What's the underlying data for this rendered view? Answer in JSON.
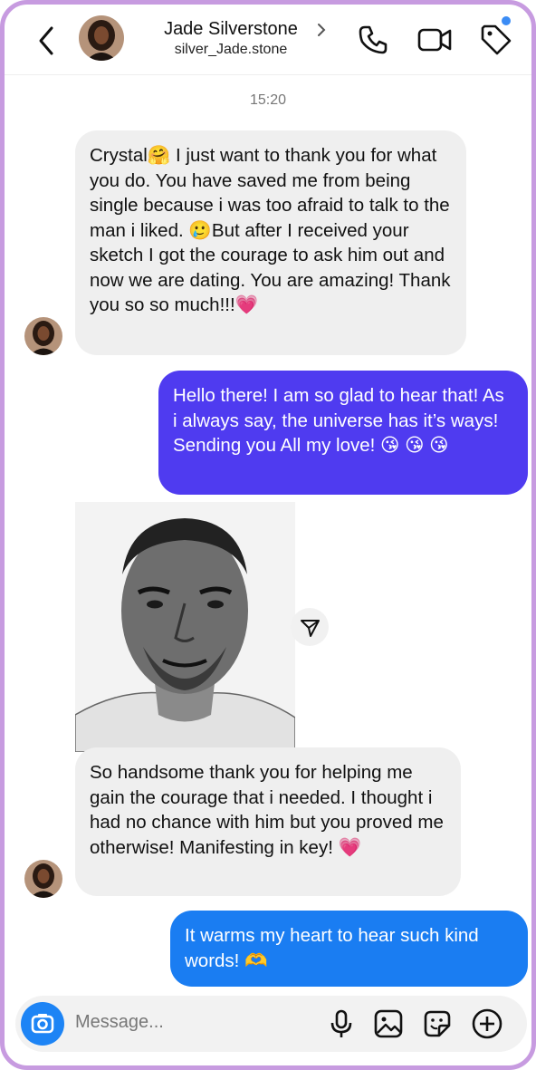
{
  "header": {
    "name": "Jade Silverstone",
    "username": "silver_Jade.stone"
  },
  "conversation": {
    "timestamp": "15:20",
    "messages": [
      {
        "side": "in",
        "text": "Crystal🤗 I just want to thank you for what you do. You have saved me from being single because i was too afraid to talk to the man i liked. 🥲But after I received your sketch I got the courage to ask him out and now we are dating. You are amazing! Thank you so so much!!!💗"
      },
      {
        "side": "out",
        "text": "Hello there! I am so glad to hear that! As i always say, the universe has it’s ways! Sending you All my love! 😘 😘 😘"
      },
      {
        "side": "in",
        "text": "So handsome thank you for helping me gain the courage that i needed. I thought i had no chance with him but you proved me otherwise! Manifesting in key! 💗"
      },
      {
        "side": "out",
        "text": "It warms my heart to hear such kind words! 🫶"
      }
    ]
  },
  "composer": {
    "placeholder": "Message..."
  },
  "colors": {
    "frame": "#c79be0",
    "incoming": "#efefef",
    "outgoing_purple": "#4f3bf0",
    "outgoing_blue": "#1a7df2",
    "accent": "#1d84f5"
  },
  "icons": [
    "back-arrow-icon",
    "chevron-right-icon",
    "phone-icon",
    "video-icon",
    "tag-icon",
    "share-icon",
    "camera-icon",
    "mic-icon",
    "image-icon",
    "sticker-icon",
    "plus-icon"
  ]
}
